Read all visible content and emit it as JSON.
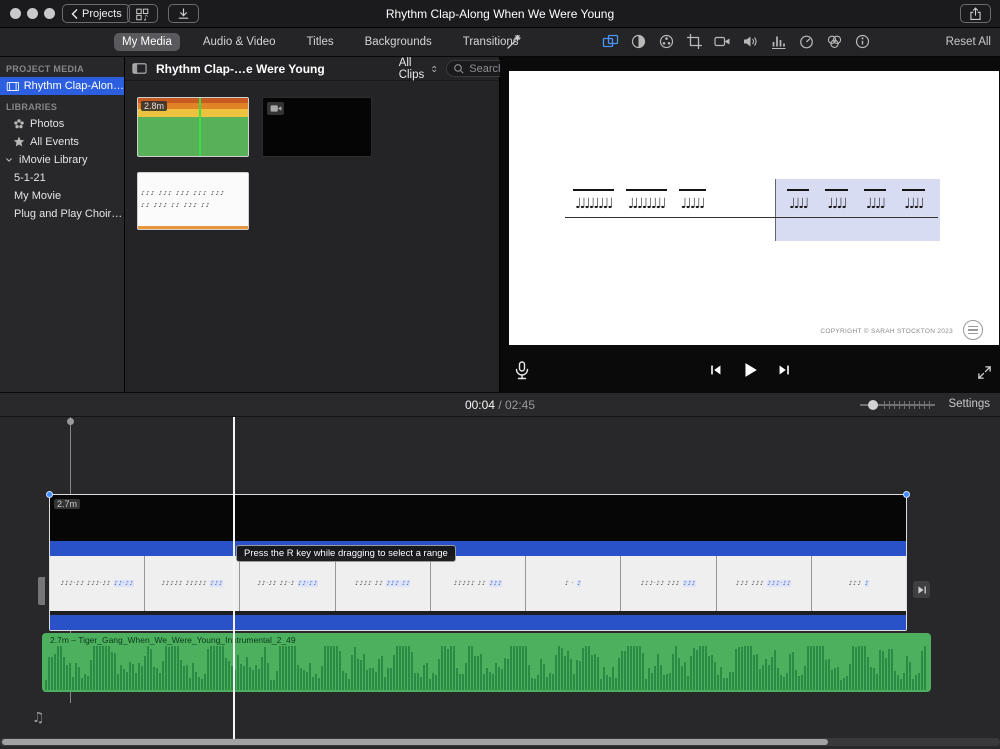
{
  "titlebar": {
    "title": "Rhythm Clap-Along When We Were Young",
    "projects": "Projects"
  },
  "tabs": {
    "items": [
      "My Media",
      "Audio & Video",
      "Titles",
      "Backgrounds",
      "Transitions"
    ],
    "active": "My Media"
  },
  "adjust": {
    "reset_all": "Reset All"
  },
  "sidebar": {
    "project_media_header": "PROJECT MEDIA",
    "project_item": "Rhythm Clap-Alon…",
    "libraries_header": "LIBRARIES",
    "items": [
      {
        "label": "Photos"
      },
      {
        "label": "All Events"
      },
      {
        "label": "iMovie Library"
      },
      {
        "label": "5-1-21"
      },
      {
        "label": "My Movie"
      },
      {
        "label": "Plug and Play Choir…"
      }
    ]
  },
  "browser": {
    "title": "Rhythm Clap-…e Were Young",
    "filter": "All Clips",
    "search_placeholder": "Search",
    "clip1_duration": "2.8m"
  },
  "viewer": {
    "copyright": "COPYRIGHT © SARAH STOCKTON 2023"
  },
  "timeline": {
    "current_time": "00:04",
    "separator": " / ",
    "total_time": "02:45",
    "settings": "Settings",
    "video_clip_duration": "2.7m",
    "audio_clip_label": "2.7m – Tiger_Gang_When_We_Were_Young_Instrumental_2_49",
    "tooltip": "Press the R key while dragging to select a range",
    "cells": [
      {
        "g": "♪♪♪·♪♪ ♪♪♪·♪♪",
        "b": "♪♪·♪♪"
      },
      {
        "g": "♪♪♪♪♪ ♪♪♪♪♪",
        "b": "♪♪♪"
      },
      {
        "g": "♪♪·♪♪ ♪♪·♪",
        "b": "♪♪·♪♪"
      },
      {
        "g": "♪♪♪♪ ♪♪",
        "b": "♪♪♪ ♪♪"
      },
      {
        "g": "♪♪♪♪♪ ♪♪",
        "b": "♪♪♪"
      },
      {
        "g": "♪ ·",
        "b": "♪"
      },
      {
        "g": "♪♪♪·♪♪ ♪♪♪",
        "b": "♪♪♪"
      },
      {
        "g": "♪♪♪ ♪♪♪",
        "b": "♪♪♪·♪♪"
      },
      {
        "g": "♪♪♪",
        "b": "♪"
      }
    ]
  },
  "decor": {
    "thumb_notation_row1": "♪♪♪ ♪♪♪ ♪♪♪ ♪♪♪ ♪♪♪",
    "thumb_notation_row2": "♪♪ ♪♪♪ ♪♪ ♪♪♪ ♪♪",
    "viewer_left": [
      "♩♩♩♩♩♩♩♩",
      "♩♩♩♩♩♩♩♩",
      "♩♩♩♩♩"
    ],
    "viewer_right": [
      "♩♩♩♩",
      "♩♩♩♩",
      "♩♩♩♩",
      "♩♩♩♩"
    ]
  }
}
